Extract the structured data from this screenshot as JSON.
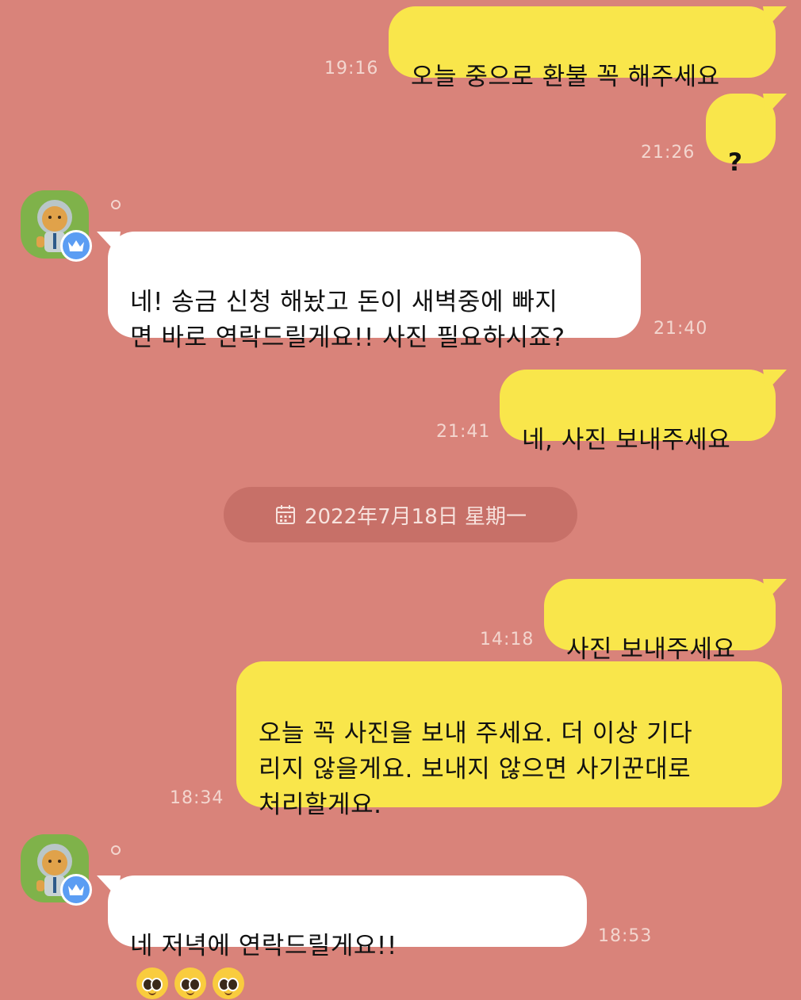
{
  "messages": [
    {
      "side": "me",
      "text": "오늘 중으로 환불 꼭 해주세요",
      "time": "19:16"
    },
    {
      "side": "me",
      "text": "?",
      "time": "21:26"
    },
    {
      "side": "them",
      "text": "네! 송금 신청 해놨고 돈이 새벽중에 빠지\n면 바로 연락드릴게요!! 사진 필요하시죠?",
      "time": "21:40"
    },
    {
      "side": "me",
      "text": "네, 사진 보내주세요",
      "time": "21:41"
    },
    {
      "side": "me",
      "text": "사진 보내주세요",
      "time": "14:18"
    },
    {
      "side": "me",
      "text": "오늘 꼭 사진을 보내 주세요. 더 이상 기다\n리지 않을게요. 보내지 않으면 사기꾼대로\n처리할게요.",
      "time": "18:34"
    },
    {
      "side": "them",
      "text": "네 저녁에 연락드릴게요!!",
      "emojis": [
        "pleading-face",
        "pleading-face",
        "pleading-face"
      ],
      "time": "18:53"
    }
  ],
  "date_divider": {
    "icon": "calendar-icon",
    "label": "2022年7月18日 星期一"
  },
  "colors": {
    "background": "#d9837a",
    "my_bubble": "#f9e64b",
    "their_bubble": "#ffffff",
    "date_pill": "#c77068",
    "timestamp": "#f3d6cf",
    "avatar": "#7fb24a",
    "badge": "#5b9df3"
  }
}
